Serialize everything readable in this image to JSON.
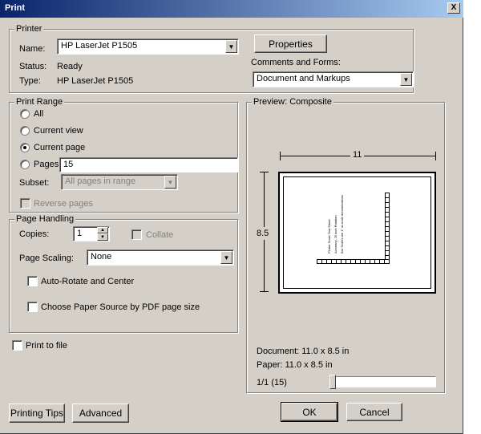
{
  "window": {
    "title": "Print",
    "close_glyph": "X"
  },
  "printer": {
    "legend": "Printer",
    "name_label": "Name:",
    "name_value": "HP LaserJet P1505",
    "status_label": "Status:",
    "status_value": "Ready",
    "type_label": "Type:",
    "type_value": "HP LaserJet P1505",
    "properties_label": "Properties",
    "comments_label": "Comments and Forms:",
    "comments_value": "Document and Markups"
  },
  "print_range": {
    "legend": "Print Range",
    "all_label": "All",
    "current_view_label": "Current view",
    "current_page_label": "Current page",
    "pages_label": "Pages",
    "pages_value": "15",
    "subset_label": "Subset:",
    "subset_value": "All pages in range",
    "reverse_label": "Reverse pages",
    "selected": "current_page"
  },
  "page_handling": {
    "legend": "Page Handling",
    "copies_label": "Copies:",
    "copies_value": "1",
    "collate_label": "Collate",
    "scaling_label": "Page Scaling:",
    "scaling_value": "None",
    "autorotate_label": "Auto-Rotate and Center",
    "paper_source_label": "Choose Paper Source by PDF page size"
  },
  "print_to_file_label": "Print to file",
  "preview": {
    "legend": "Preview: Composite",
    "width_dim": "11",
    "height_dim": "8.5",
    "page_text_lines": [
      "Plotter Scale Test Sheet",
      "Accuracy: 25 inch Rotation",
      "Bar Scales are 1\" at scale denominations"
    ],
    "document_size": "Document: 11.0 x 8.5 in",
    "paper_size": "Paper: 11.0 x 8.5 in",
    "page_counter": "1/1 (15)",
    "slider_position": 0
  },
  "buttons": {
    "printing_tips": "Printing Tips",
    "advanced": "Advanced",
    "ok": "OK",
    "cancel": "Cancel"
  },
  "icons": {
    "dropdown": "triangle-down-icon",
    "spin_up": "triangle-up-icon",
    "spin_down": "triangle-down-icon"
  }
}
